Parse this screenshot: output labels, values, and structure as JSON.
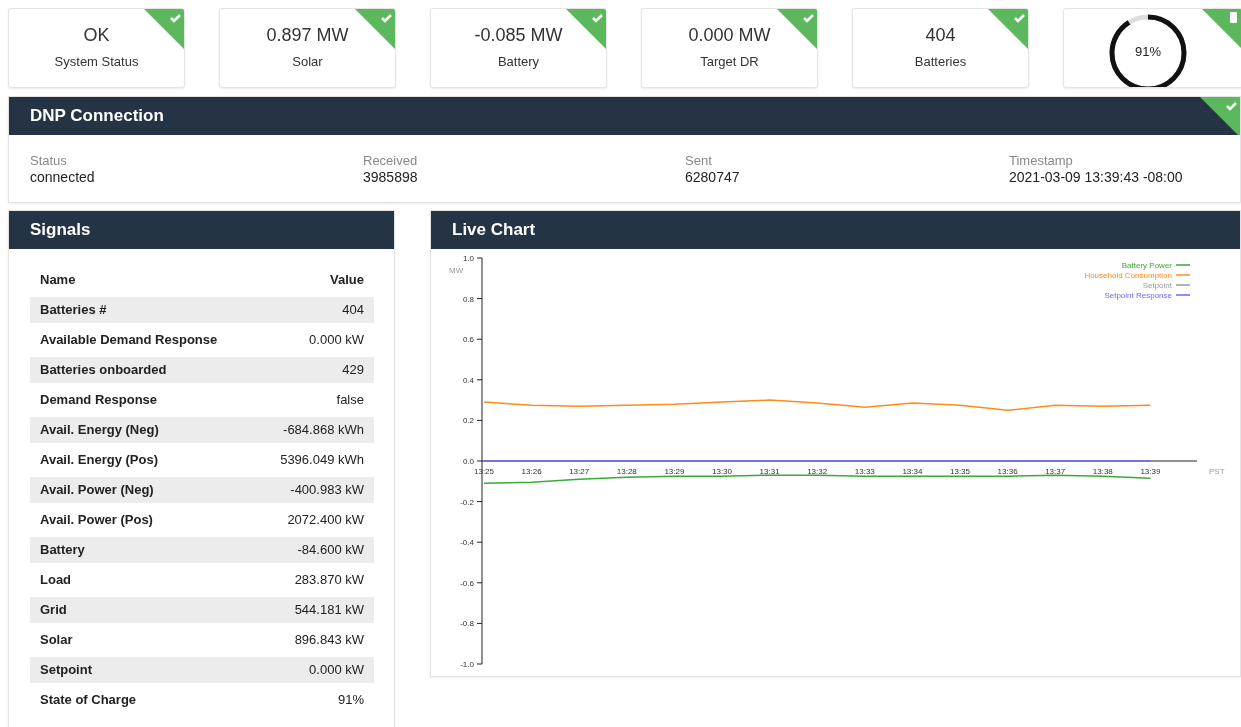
{
  "cards": [
    {
      "kind": "stat",
      "value": "OK",
      "label": "System Status",
      "checked": true
    },
    {
      "kind": "stat",
      "value": "0.897 MW",
      "label": "Solar",
      "checked": true
    },
    {
      "kind": "stat",
      "value": "-0.085 MW",
      "label": "Battery",
      "checked": true
    },
    {
      "kind": "stat",
      "value": "0.000 MW",
      "label": "Target DR",
      "checked": true
    },
    {
      "kind": "stat",
      "value": "404",
      "label": "Batteries",
      "checked": true
    },
    {
      "kind": "gauge",
      "value": "91%",
      "level": 0.91
    }
  ],
  "dnp": {
    "title": "DNP Connection",
    "checked": true,
    "fields": [
      {
        "label": "Status",
        "value": "connected"
      },
      {
        "label": "Received",
        "value": "3985898"
      },
      {
        "label": "Sent",
        "value": "6280747"
      },
      {
        "label": "Timestamp",
        "value": "2021-03-09 13:39:43 -08:00"
      }
    ]
  },
  "signals": {
    "title": "Signals",
    "columns": [
      "Name",
      "Value"
    ],
    "rows": [
      [
        "Batteries #",
        "404"
      ],
      [
        "Available Demand Response",
        "0.000 kW"
      ],
      [
        "Batteries onboarded",
        "429"
      ],
      [
        "Demand Response",
        "false"
      ],
      [
        "Avail. Energy (Neg)",
        "-684.868 kWh"
      ],
      [
        "Avail. Energy (Pos)",
        "5396.049 kWh"
      ],
      [
        "Avail. Power (Neg)",
        "-400.983 kW"
      ],
      [
        "Avail. Power (Pos)",
        "2072.400 kW"
      ],
      [
        "Battery",
        "-84.600 kW"
      ],
      [
        "Load",
        "283.870 kW"
      ],
      [
        "Grid",
        "544.181 kW"
      ],
      [
        "Solar",
        "896.843 kW"
      ],
      [
        "Setpoint",
        "0.000 kW"
      ],
      [
        "State of Charge",
        "91%"
      ]
    ]
  },
  "live_chart": {
    "title": "Live Chart",
    "chart_data": {
      "type": "line",
      "ylabel": "MW",
      "xlabel": "PST",
      "x": [
        "13:25",
        "13:26",
        "13:27",
        "13:28",
        "13:29",
        "13:30",
        "13:31",
        "13:32",
        "13:33",
        "13:34",
        "13:35",
        "13:36",
        "13:37",
        "13:38",
        "13:39"
      ],
      "ylim": [
        -1.0,
        1.0
      ],
      "legend": "top-right",
      "yticks": [
        {
          "value": 1.0,
          "label": "1.0"
        },
        {
          "value": 0.8,
          "label": "0.8"
        },
        {
          "value": 0.6,
          "label": "0.6"
        },
        {
          "value": 0.4,
          "label": "0.4"
        },
        {
          "value": 0.2,
          "label": "0.2"
        },
        {
          "value": 0.0,
          "label": "0.0"
        },
        {
          "value": -0.2,
          "label": "-0.2"
        },
        {
          "value": -0.4,
          "label": "-0.4"
        },
        {
          "value": -0.6,
          "label": "-0.6"
        },
        {
          "value": -0.8,
          "label": "-0.8"
        },
        {
          "value": -1.0,
          "label": "-1.0"
        }
      ],
      "series": [
        {
          "name": "Battery Power",
          "color": "#3aaa35",
          "values": [
            -0.11,
            -0.105,
            -0.09,
            -0.08,
            -0.075,
            -0.075,
            -0.07,
            -0.07,
            -0.075,
            -0.075,
            -0.075,
            -0.075,
            -0.07,
            -0.075,
            -0.085
          ]
        },
        {
          "name": "Household Consumption",
          "color": "#ff8c1a",
          "values": [
            0.29,
            0.275,
            0.27,
            0.275,
            0.28,
            0.29,
            0.3,
            0.285,
            0.265,
            0.285,
            0.275,
            0.25,
            0.275,
            0.27,
            0.275
          ]
        },
        {
          "name": "Setpoint",
          "color": "#999999",
          "values": [
            null,
            null,
            null,
            null,
            null,
            null,
            null,
            null,
            null,
            null,
            null,
            null,
            null,
            null,
            null
          ]
        },
        {
          "name": "Setpoint Response",
          "color": "#6a6aff",
          "values": [
            0,
            0,
            0,
            0,
            0,
            0,
            0,
            0,
            0,
            0,
            0,
            0,
            0,
            0,
            0
          ]
        }
      ]
    }
  }
}
